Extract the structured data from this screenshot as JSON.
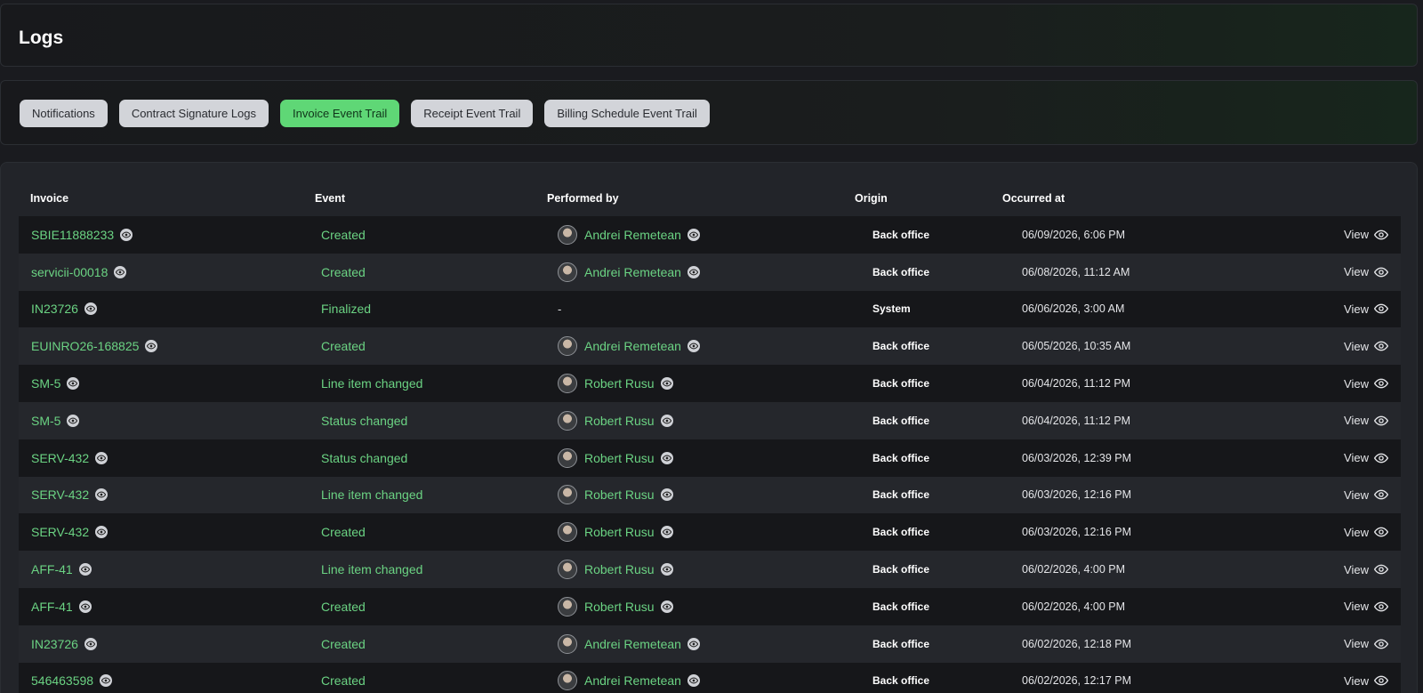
{
  "header": {
    "title": "Logs"
  },
  "tabs": [
    {
      "label": "Notifications",
      "active": false
    },
    {
      "label": "Contract Signature Logs",
      "active": false
    },
    {
      "label": "Invoice Event Trail",
      "active": true
    },
    {
      "label": "Receipt Event Trail",
      "active": false
    },
    {
      "label": "Billing Schedule Event Trail",
      "active": false
    }
  ],
  "table": {
    "columns": {
      "invoice": "Invoice",
      "event": "Event",
      "performed_by": "Performed by",
      "origin": "Origin",
      "occurred_at": "Occurred at"
    },
    "view_label": "View",
    "rows": [
      {
        "invoice": "SBIE11888233",
        "event": "Created",
        "performer": "Andrei Remetean",
        "origin": "Back office",
        "occurred_at": "06/09/2026, 6:06 PM"
      },
      {
        "invoice": "servicii-00018",
        "event": "Created",
        "performer": "Andrei Remetean",
        "origin": "Back office",
        "occurred_at": "06/08/2026, 11:12 AM"
      },
      {
        "invoice": "IN23726",
        "event": "Finalized",
        "performer": "-",
        "origin": "System",
        "occurred_at": "06/06/2026, 3:00 AM"
      },
      {
        "invoice": "EUINRO26-168825",
        "event": "Created",
        "performer": "Andrei Remetean",
        "origin": "Back office",
        "occurred_at": "06/05/2026, 10:35 AM"
      },
      {
        "invoice": "SM-5",
        "event": "Line item changed",
        "performer": "Robert Rusu",
        "origin": "Back office",
        "occurred_at": "06/04/2026, 11:12 PM"
      },
      {
        "invoice": "SM-5",
        "event": "Status changed",
        "performer": "Robert Rusu",
        "origin": "Back office",
        "occurred_at": "06/04/2026, 11:12 PM"
      },
      {
        "invoice": "SERV-432",
        "event": "Status changed",
        "performer": "Robert Rusu",
        "origin": "Back office",
        "occurred_at": "06/03/2026, 12:39 PM"
      },
      {
        "invoice": "SERV-432",
        "event": "Line item changed",
        "performer": "Robert Rusu",
        "origin": "Back office",
        "occurred_at": "06/03/2026, 12:16 PM"
      },
      {
        "invoice": "SERV-432",
        "event": "Created",
        "performer": "Robert Rusu",
        "origin": "Back office",
        "occurred_at": "06/03/2026, 12:16 PM"
      },
      {
        "invoice": "AFF-41",
        "event": "Line item changed",
        "performer": "Robert Rusu",
        "origin": "Back office",
        "occurred_at": "06/02/2026, 4:00 PM"
      },
      {
        "invoice": "AFF-41",
        "event": "Created",
        "performer": "Robert Rusu",
        "origin": "Back office",
        "occurred_at": "06/02/2026, 4:00 PM"
      },
      {
        "invoice": "IN23726",
        "event": "Created",
        "performer": "Andrei Remetean",
        "origin": "Back office",
        "occurred_at": "06/02/2026, 12:18 PM"
      },
      {
        "invoice": "546463598",
        "event": "Created",
        "performer": "Andrei Remetean",
        "origin": "Back office",
        "occurred_at": "06/02/2026, 12:17 PM"
      }
    ]
  },
  "icons": {
    "eye": "eye-icon",
    "avatar": "avatar"
  },
  "colors": {
    "accent": "#5fd776",
    "link": "#6bd383",
    "tab_inactive": "#d2d4d9",
    "background": "#1a1b1f"
  }
}
